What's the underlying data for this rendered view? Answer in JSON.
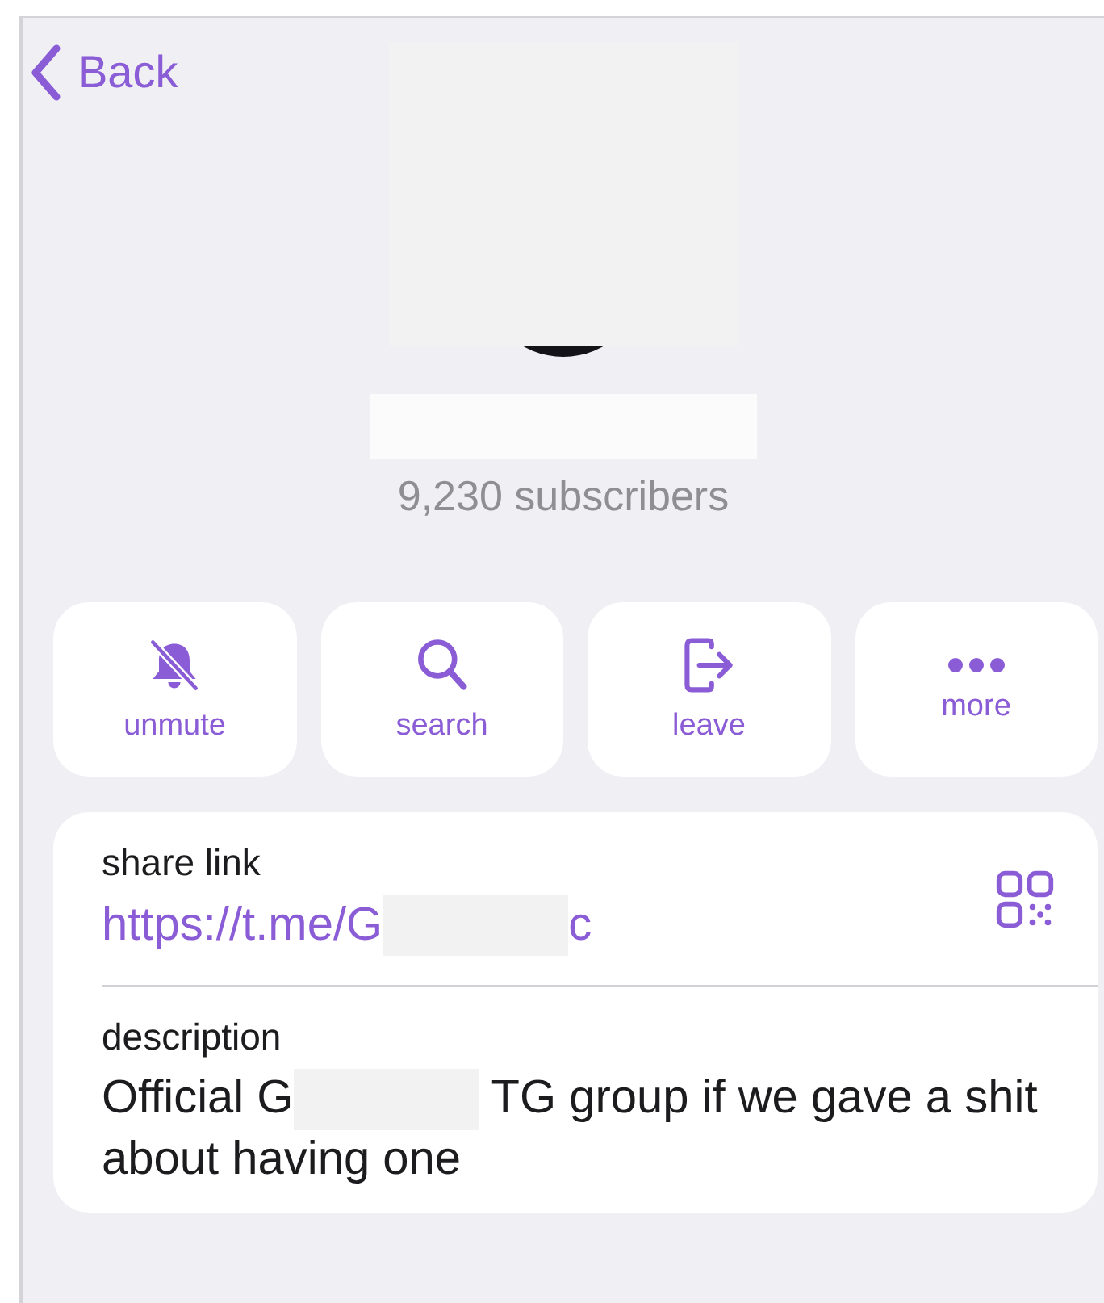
{
  "nav": {
    "back_label": "Back"
  },
  "profile": {
    "subscribers": "9,230 subscribers"
  },
  "actions": [
    {
      "kind": "unmute",
      "label": "unmute"
    },
    {
      "kind": "search",
      "label": "search"
    },
    {
      "kind": "leave",
      "label": "leave"
    },
    {
      "kind": "more",
      "label": "more"
    }
  ],
  "share_link": {
    "label": "share link",
    "value_start": "https://t.me/G",
    "value_end": "c"
  },
  "description": {
    "label": "description",
    "text_start": "Official G",
    "text_end": "TG group if we gave a shit about having one"
  }
}
